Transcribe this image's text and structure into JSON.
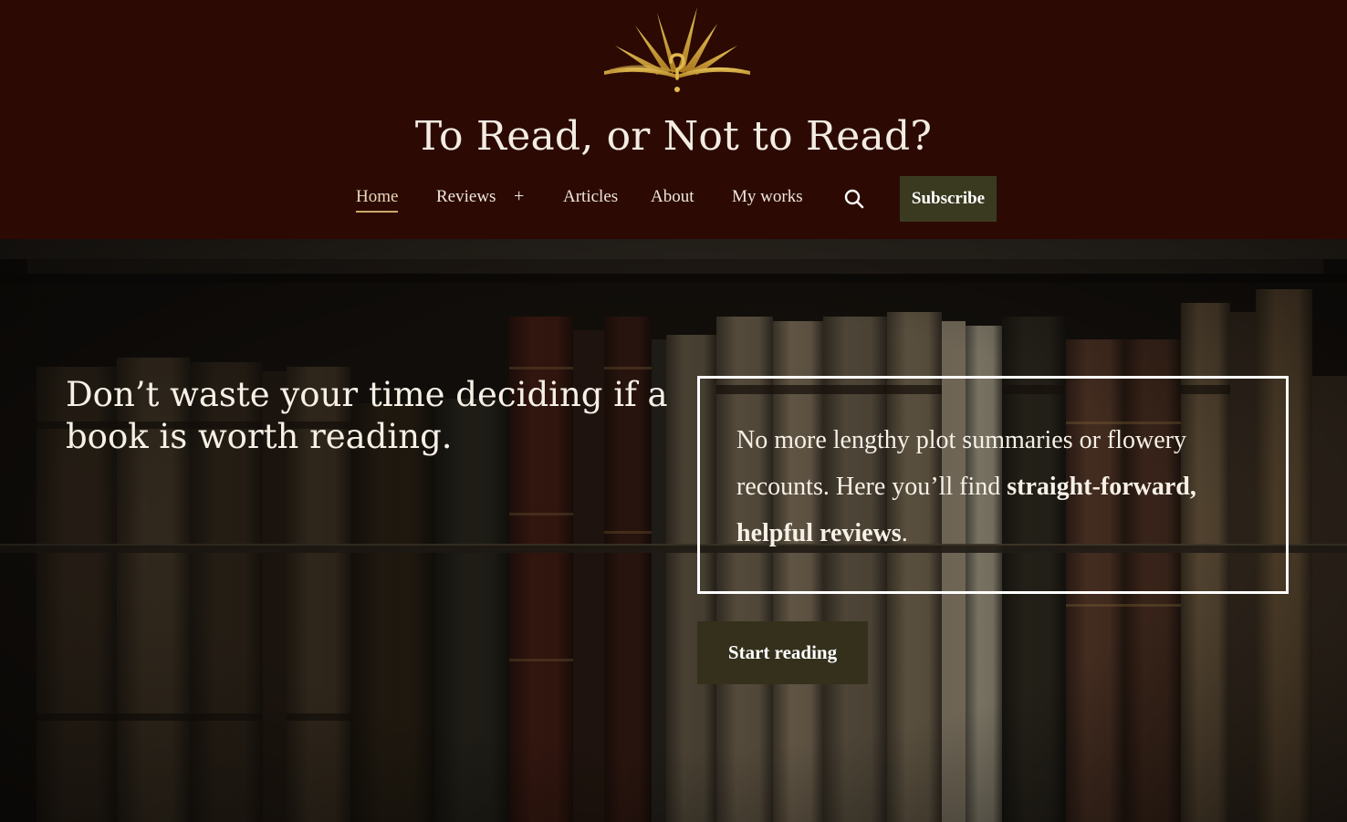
{
  "site": {
    "title": "To Read, or Not to Read?",
    "logo_icon": "open-book-question-icon"
  },
  "nav": {
    "items": [
      {
        "label": "Home",
        "active": true
      },
      {
        "label": "Reviews",
        "has_submenu": true
      },
      {
        "label": "Articles"
      },
      {
        "label": "About"
      },
      {
        "label": "My works"
      }
    ],
    "submenu_toggle": "+",
    "search_icon": "search-icon",
    "subscribe_label": "Subscribe"
  },
  "hero": {
    "heading": "Don’t waste your time deciding if a book is worth reading.",
    "intro_plain": "No more lengthy plot summaries or flowery recounts. Here you’ll find ",
    "intro_bold": "straight-forward, helpful reviews",
    "intro_end": ".",
    "cta_label": "Start reading"
  },
  "colors": {
    "header_bg": "#2c0a03",
    "button_bg": "#3a3a20",
    "accent_gold": "#c9a96a",
    "text_light": "#f3ece2"
  }
}
